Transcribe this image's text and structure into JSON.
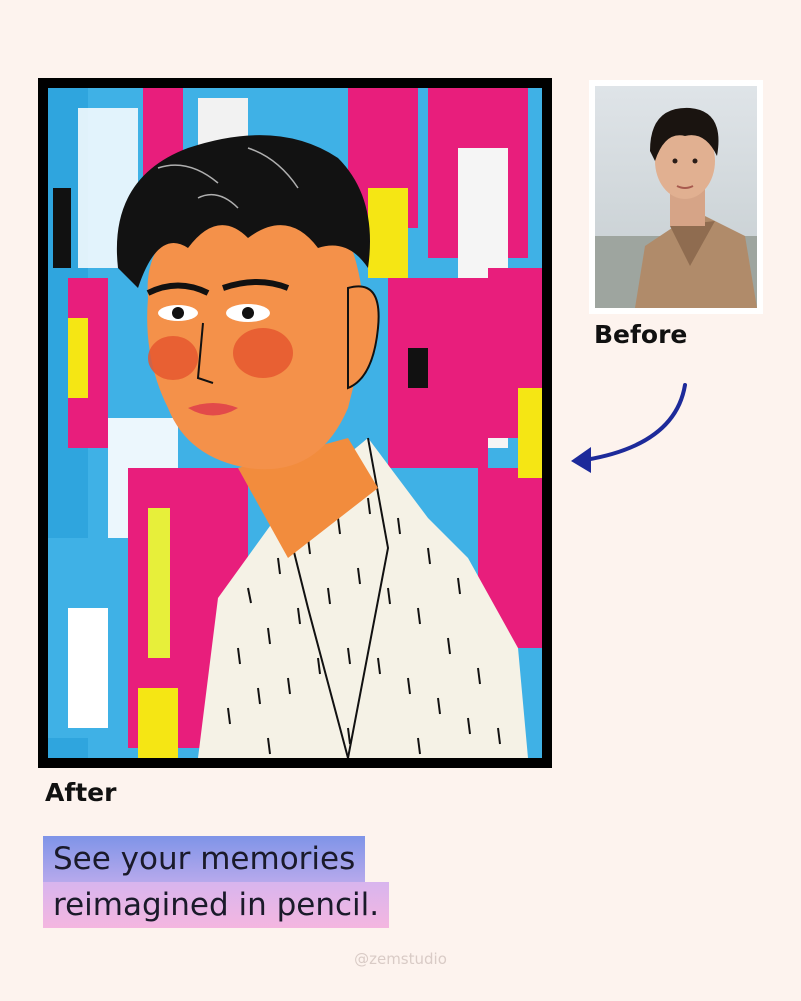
{
  "labels": {
    "before": "Before",
    "after": "After"
  },
  "caption": {
    "line1": "See your memories",
    "line2": "reimagined in pencil."
  },
  "handle": "@zemstudio",
  "colors": {
    "background": "#fdf3ee",
    "arrow": "#1d2a9a",
    "caption_highlight_top": "#7f94e8",
    "caption_highlight_bottom": "#f4b6e0"
  },
  "images": {
    "after": "painted-portrait",
    "before": "portrait-photo"
  }
}
